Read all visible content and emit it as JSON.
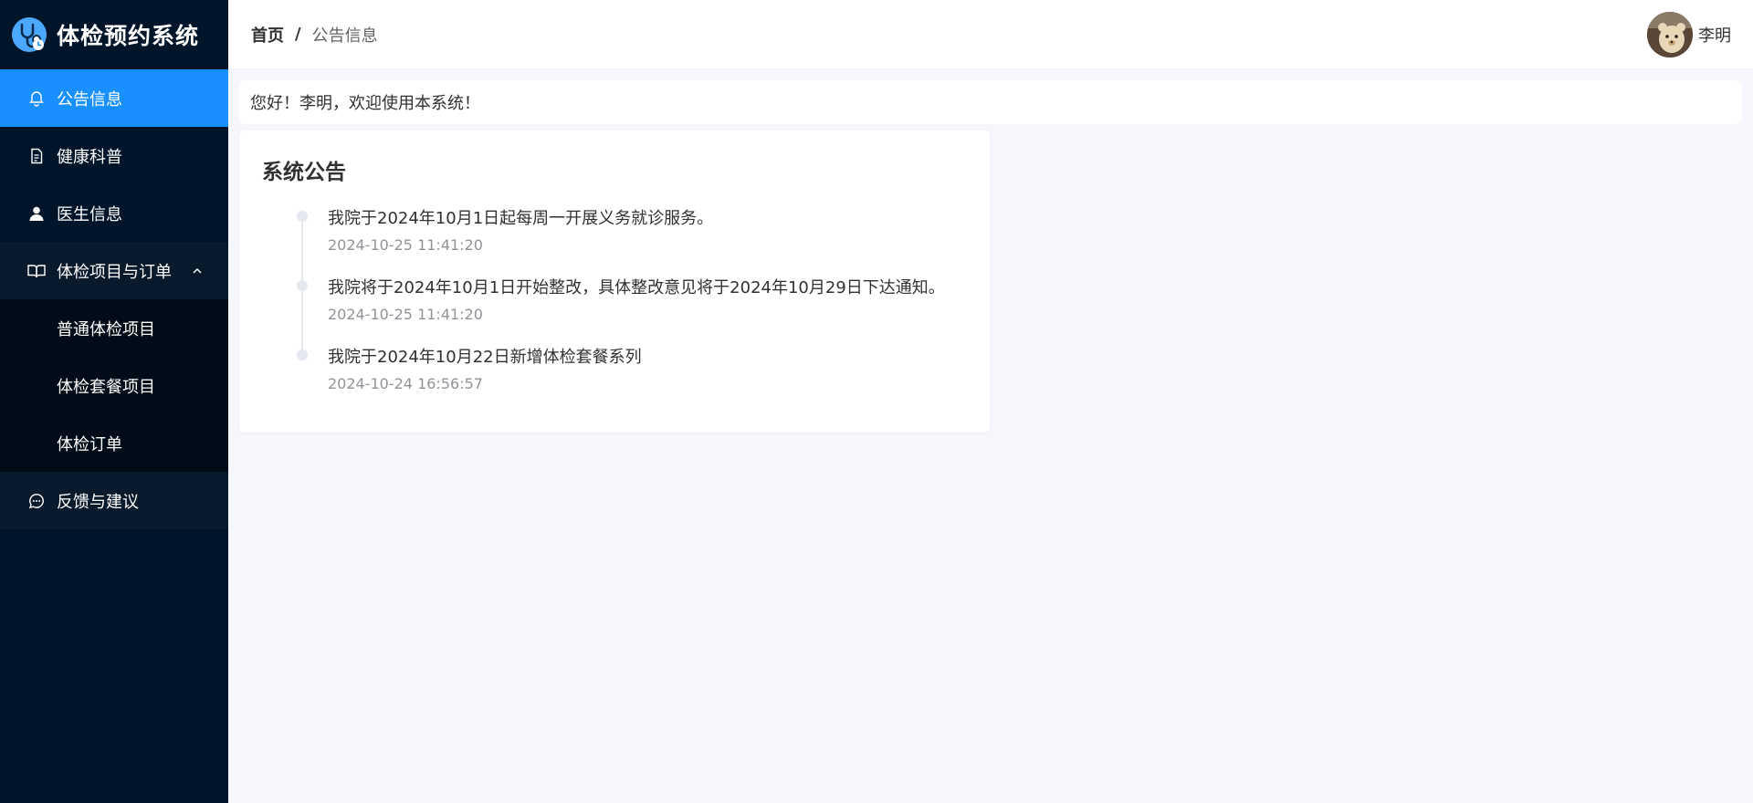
{
  "app": {
    "title": "体检预约系统"
  },
  "sidebar": {
    "items": [
      {
        "label": "公告信息",
        "icon": "bell-icon",
        "active": true
      },
      {
        "label": "健康科普",
        "icon": "document-icon"
      },
      {
        "label": "医生信息",
        "icon": "user-icon"
      },
      {
        "label": "体检项目与订单",
        "icon": "book-icon",
        "expanded": true,
        "children": [
          {
            "label": "普通体检项目"
          },
          {
            "label": "体检套餐项目"
          },
          {
            "label": "体检订单"
          }
        ]
      },
      {
        "label": "反馈与建议",
        "icon": "chat-icon"
      }
    ]
  },
  "header": {
    "breadcrumb": {
      "home": "首页",
      "separator": "/",
      "current": "公告信息"
    },
    "user": {
      "name": "李明"
    }
  },
  "welcome": {
    "text": "您好！李明，欢迎使用本系统！"
  },
  "notice": {
    "title": "系统公告",
    "items": [
      {
        "content": "我院于2024年10月1日起每周一开展义务就诊服务。",
        "time": "2024-10-25 11:41:20"
      },
      {
        "content": "我院将于2024年10月1日开始整改，具体整改意见将于2024年10月29日下达通知。",
        "time": "2024-10-25 11:41:20"
      },
      {
        "content": "我院于2024年10月22日新增体检套餐系列",
        "time": "2024-10-24 16:56:57"
      }
    ]
  },
  "colors": {
    "sidebar_bg": "#001529",
    "submenu_bg": "#000c17",
    "active": "#1890ff",
    "page_bg": "#f5f7fc"
  }
}
